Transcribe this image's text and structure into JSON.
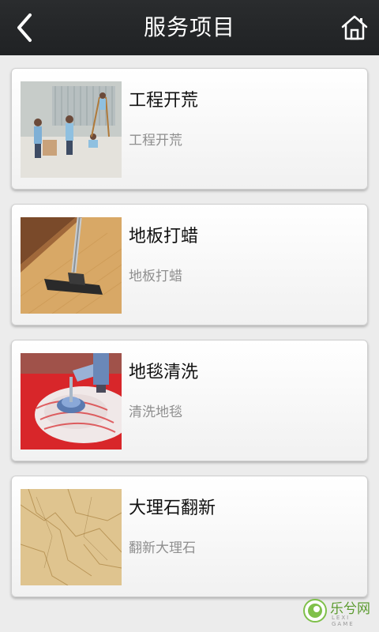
{
  "header": {
    "title": "服务项目",
    "back_icon": "chevron-left-icon",
    "home_icon": "home-icon"
  },
  "services": [
    {
      "title": "工程开荒",
      "subtitle": "工程开荒"
    },
    {
      "title": "地板打蜡",
      "subtitle": "地板打蜡"
    },
    {
      "title": "地毯清洗",
      "subtitle": "清洗地毯"
    },
    {
      "title": "大理石翻新",
      "subtitle": "翻新大理石"
    }
  ],
  "watermark": {
    "text": "乐兮网",
    "sub": "LEXI GAME"
  }
}
